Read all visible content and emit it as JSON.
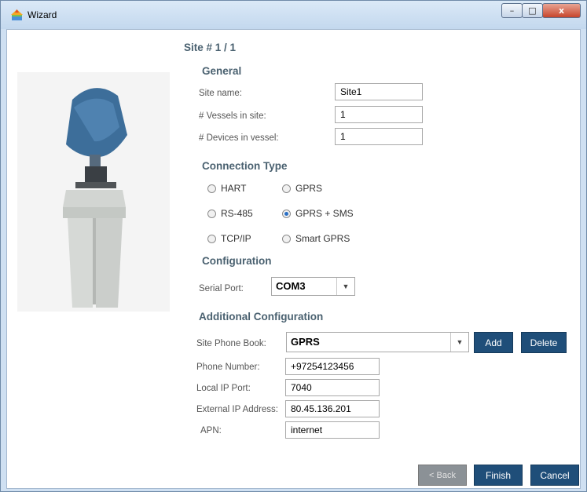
{
  "window": {
    "title": "Wizard",
    "min_glyph": "–",
    "max_glyph": "□",
    "close_glyph": "x"
  },
  "wizard": {
    "site_title": "Site # 1 / 1",
    "general": {
      "heading": "General",
      "site_name_label": "Site name:",
      "site_name_value": "Site1",
      "vessels_label": "# Vessels in site:",
      "vessels_value": "1",
      "devices_label": "# Devices in vessel:",
      "devices_value": "1"
    },
    "connection": {
      "heading": "Connection Type",
      "options": [
        "HART",
        "GPRS",
        "RS-485",
        "GPRS + SMS",
        "TCP/IP",
        "Smart GPRS"
      ],
      "selected": "GPRS + SMS"
    },
    "configuration": {
      "heading": "Configuration",
      "serial_port_label": "Serial Port:",
      "serial_port_value": "COM3"
    },
    "additional": {
      "heading": "Additional Configuration",
      "phone_book_label": "Site Phone Book:",
      "phone_book_value": "GPRS",
      "add_label": "Add",
      "delete_label": "Delete",
      "phone_number_label": "Phone Number:",
      "phone_number_value": "+97254123456",
      "local_ip_port_label": "Local IP Port:",
      "local_ip_port_value": "7040",
      "external_ip_label": "External IP Address:",
      "external_ip_value": "80.45.136.201",
      "apn_label": "APN:",
      "apn_value": "internet"
    },
    "footer": {
      "back_label": "< Back",
      "finish_label": "Finish",
      "cancel_label": "Cancel"
    }
  },
  "icons": {
    "app": "wizard-app-icon",
    "dropdown": "chevron-down-icon",
    "device": "ultrasonic-level-sensor-image"
  },
  "colors": {
    "heading": "#4a6170",
    "button": "#1f4e79",
    "button_disabled": "#8b9196",
    "radio_selected": "#2a6fc4",
    "titlebar": "#c3d8ee"
  }
}
